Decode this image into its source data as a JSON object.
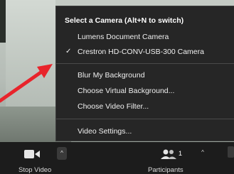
{
  "menu": {
    "header": "Select a Camera (Alt+N to switch)",
    "cameras": [
      {
        "label": "Lumens Document Camera",
        "checked": false
      },
      {
        "label": "Crestron HD-CONV-USB-300 Camera",
        "checked": true
      }
    ],
    "check_glyph": "✓",
    "background_items": [
      {
        "label": "Blur My Background"
      },
      {
        "label": "Choose Virtual Background..."
      },
      {
        "label": "Choose Video Filter..."
      }
    ],
    "settings_label": "Video Settings..."
  },
  "toolbar": {
    "stop_video_label": "Stop Video",
    "participants_label": "Participants",
    "participants_count": "1",
    "caret_glyph": "^"
  },
  "colors": {
    "menu_bg": "#262626",
    "toolbar_bg": "#1c1c1c",
    "arrow": "#e8242b"
  },
  "icons": [
    "video-camera-icon",
    "participants-icon",
    "caret-up-icon",
    "checkmark-icon"
  ]
}
